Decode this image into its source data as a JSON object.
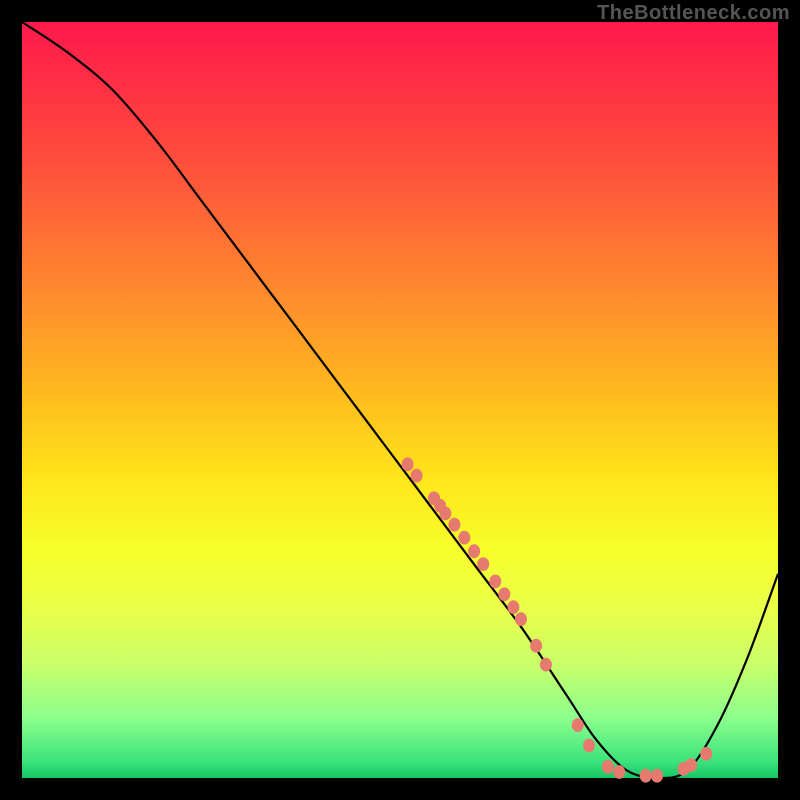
{
  "watermark": "TheBottleneck.com",
  "colors": {
    "frame": "#000000",
    "point": "#e77a6e",
    "line": "#000000"
  },
  "chart_data": {
    "type": "line",
    "title": "",
    "xlabel": "",
    "ylabel": "",
    "xlim": [
      0,
      100
    ],
    "ylim": [
      0,
      100
    ],
    "grid": false,
    "legend": false,
    "series": [
      {
        "name": "curve",
        "x": [
          0,
          6,
          12,
          18,
          24,
          30,
          36,
          42,
          48,
          54,
          60,
          66,
          72,
          76,
          80,
          84,
          88,
          92,
          96,
          100
        ],
        "y": [
          100,
          96,
          91,
          84,
          76,
          68,
          60,
          52,
          44,
          36,
          28,
          20,
          11,
          5,
          1,
          0,
          1,
          7,
          16,
          27
        ]
      }
    ],
    "points": [
      {
        "x": 51.0,
        "y": 41.5
      },
      {
        "x": 52.2,
        "y": 40.0
      },
      {
        "x": 54.5,
        "y": 37.0
      },
      {
        "x": 55.3,
        "y": 36.0
      },
      {
        "x": 56.0,
        "y": 35.0
      },
      {
        "x": 57.2,
        "y": 33.5
      },
      {
        "x": 58.5,
        "y": 31.8
      },
      {
        "x": 59.8,
        "y": 30.0
      },
      {
        "x": 61.0,
        "y": 28.3
      },
      {
        "x": 62.6,
        "y": 26.0
      },
      {
        "x": 63.8,
        "y": 24.3
      },
      {
        "x": 65.0,
        "y": 22.6
      },
      {
        "x": 66.0,
        "y": 21.0
      },
      {
        "x": 68.0,
        "y": 17.5
      },
      {
        "x": 69.3,
        "y": 15.0
      },
      {
        "x": 73.5,
        "y": 7.0
      },
      {
        "x": 75.0,
        "y": 4.3
      },
      {
        "x": 77.5,
        "y": 1.5
      },
      {
        "x": 79.0,
        "y": 0.8
      },
      {
        "x": 82.5,
        "y": 0.3
      },
      {
        "x": 84.0,
        "y": 0.3
      },
      {
        "x": 87.5,
        "y": 1.2
      },
      {
        "x": 88.5,
        "y": 1.7
      },
      {
        "x": 90.5,
        "y": 3.2
      }
    ],
    "point_radius": 6
  }
}
